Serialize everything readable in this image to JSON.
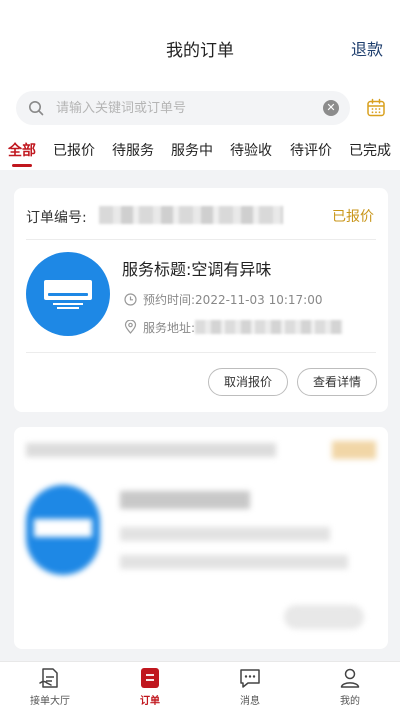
{
  "header": {
    "title": "我的订单",
    "refund_label": "退款"
  },
  "search": {
    "placeholder": "请输入关键词或订单号",
    "value": ""
  },
  "tabs": [
    {
      "label": "全部",
      "active": true
    },
    {
      "label": "已报价"
    },
    {
      "label": "待服务"
    },
    {
      "label": "服务中"
    },
    {
      "label": "待验收"
    },
    {
      "label": "待评价"
    },
    {
      "label": "已完成"
    }
  ],
  "order": {
    "number_label": "订单编号:",
    "status": "已报价",
    "title": "服务标题:空调有异味",
    "time_label": "预约时间:",
    "time_value": "2022-11-03 10:17:00",
    "address_label": "服务地址:",
    "cancel_label": "取消报价",
    "detail_label": "查看详情"
  },
  "bottom_nav": [
    {
      "label": "接单大厅",
      "icon": "hall-icon"
    },
    {
      "label": "订单",
      "icon": "order-icon",
      "active": true
    },
    {
      "label": "消息",
      "icon": "message-icon"
    },
    {
      "label": "我的",
      "icon": "user-icon"
    }
  ],
  "colors": {
    "accent": "#c0171e",
    "status_quoted": "#c9961a",
    "service_blue": "#1e88e5",
    "refund_link": "#1f3f6e"
  }
}
